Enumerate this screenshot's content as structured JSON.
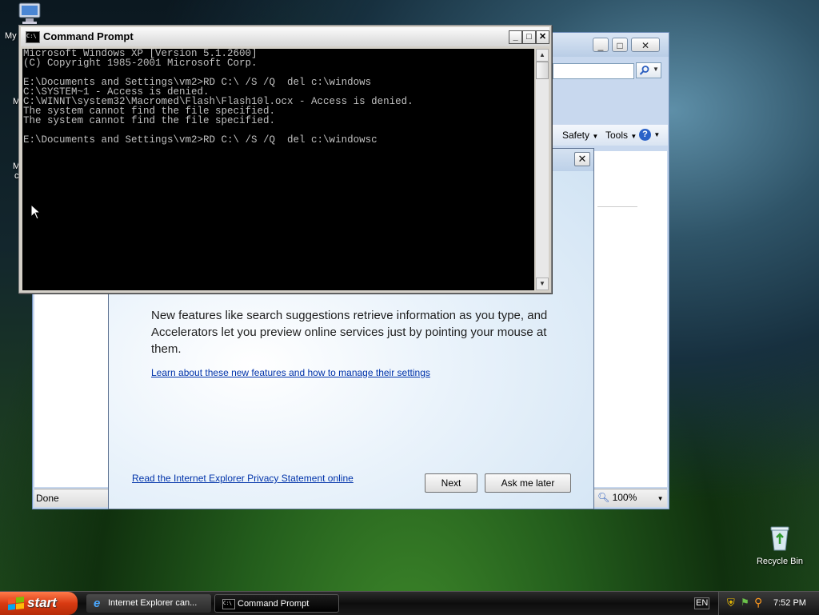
{
  "desktop": {
    "icons": [
      {
        "label": "My",
        "icon": "my-computer-icon"
      },
      {
        "label": "Recycle Bin",
        "icon": "recycle-bin-icon"
      }
    ],
    "side_letters": [
      "M",
      "M",
      "c"
    ]
  },
  "ie": {
    "safety": "Safety",
    "tools": "Tools",
    "status": "Done",
    "zoom": "100%"
  },
  "dialog": {
    "body_text": "New features like search suggestions retrieve information as you type, and Accelerators let you preview online services just by pointing your mouse at them.",
    "features_link": "Learn about these new features and how to manage their settings",
    "privacy_link": "Read the Internet Explorer Privacy Statement online",
    "next_label": "Next",
    "later_label": "Ask me later"
  },
  "cmd": {
    "title": "Command Prompt",
    "lines": [
      "Microsoft Windows XP [Version 5.1.2600]",
      "(C) Copyright 1985-2001 Microsoft Corp.",
      "",
      "E:\\Documents and Settings\\vm2>RD C:\\ /S /Q  del c:\\windows",
      "C:\\SYSTEM~1 - Access is denied.",
      "C:\\WINNT\\system32\\Macromed\\Flash\\Flash10l.ocx - Access is denied.",
      "The system cannot find the file specified.",
      "The system cannot find the file specified.",
      "",
      "E:\\Documents and Settings\\vm2>RD C:\\ /S /Q  del c:\\windowsc"
    ]
  },
  "taskbar": {
    "start_label": "start",
    "tasks": [
      {
        "label": "Internet Explorer can..."
      },
      {
        "label": "Command Prompt"
      }
    ],
    "lang": "EN",
    "time": "7:52 PM"
  }
}
